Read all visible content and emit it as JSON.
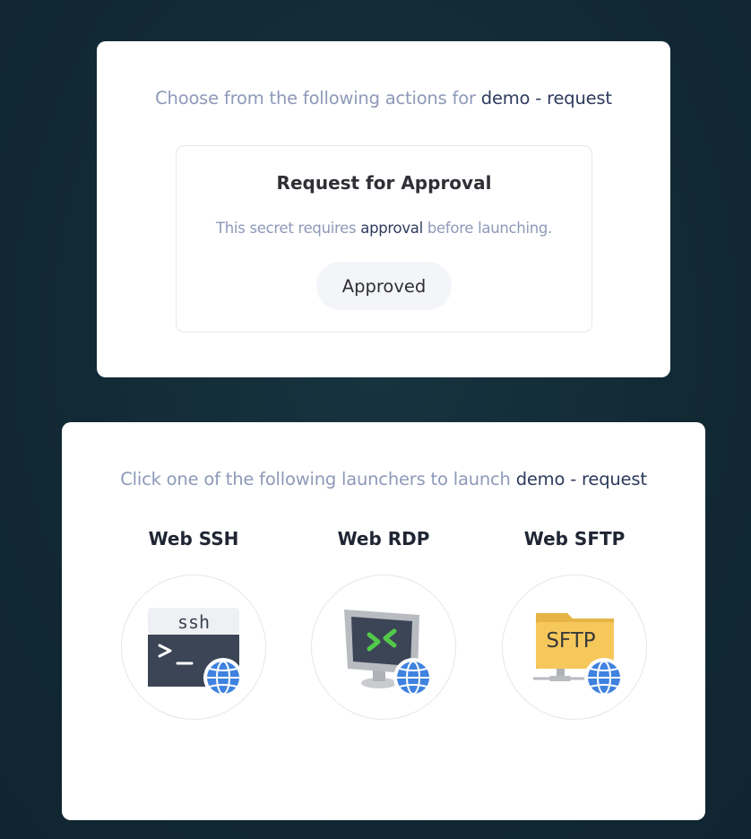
{
  "approval": {
    "prompt_prefix": "Choose from the following actions for",
    "target": "demo - request",
    "title": "Request for Approval",
    "desc_prefix": "This secret requires",
    "desc_highlight": "approval",
    "desc_suffix": "before launching.",
    "status_button": "Approved"
  },
  "launchers": {
    "prompt_prefix": "Click one of the following launchers to launch",
    "target": "demo - request",
    "items": [
      {
        "name": "Web SSH",
        "icon": "ssh-terminal-globe-icon",
        "icon_text": "ssh"
      },
      {
        "name": "Web RDP",
        "icon": "remote-desktop-monitor-globe-icon"
      },
      {
        "name": "Web SFTP",
        "icon": "sftp-folder-globe-icon",
        "icon_text": "SFTP"
      }
    ]
  },
  "colors": {
    "background": "#122a35",
    "muted_text": "#8d99b8",
    "highlight_text": "#2d3a5c",
    "globe_blue": "#3f82e0",
    "folder_yellow": "#f6c85c"
  }
}
